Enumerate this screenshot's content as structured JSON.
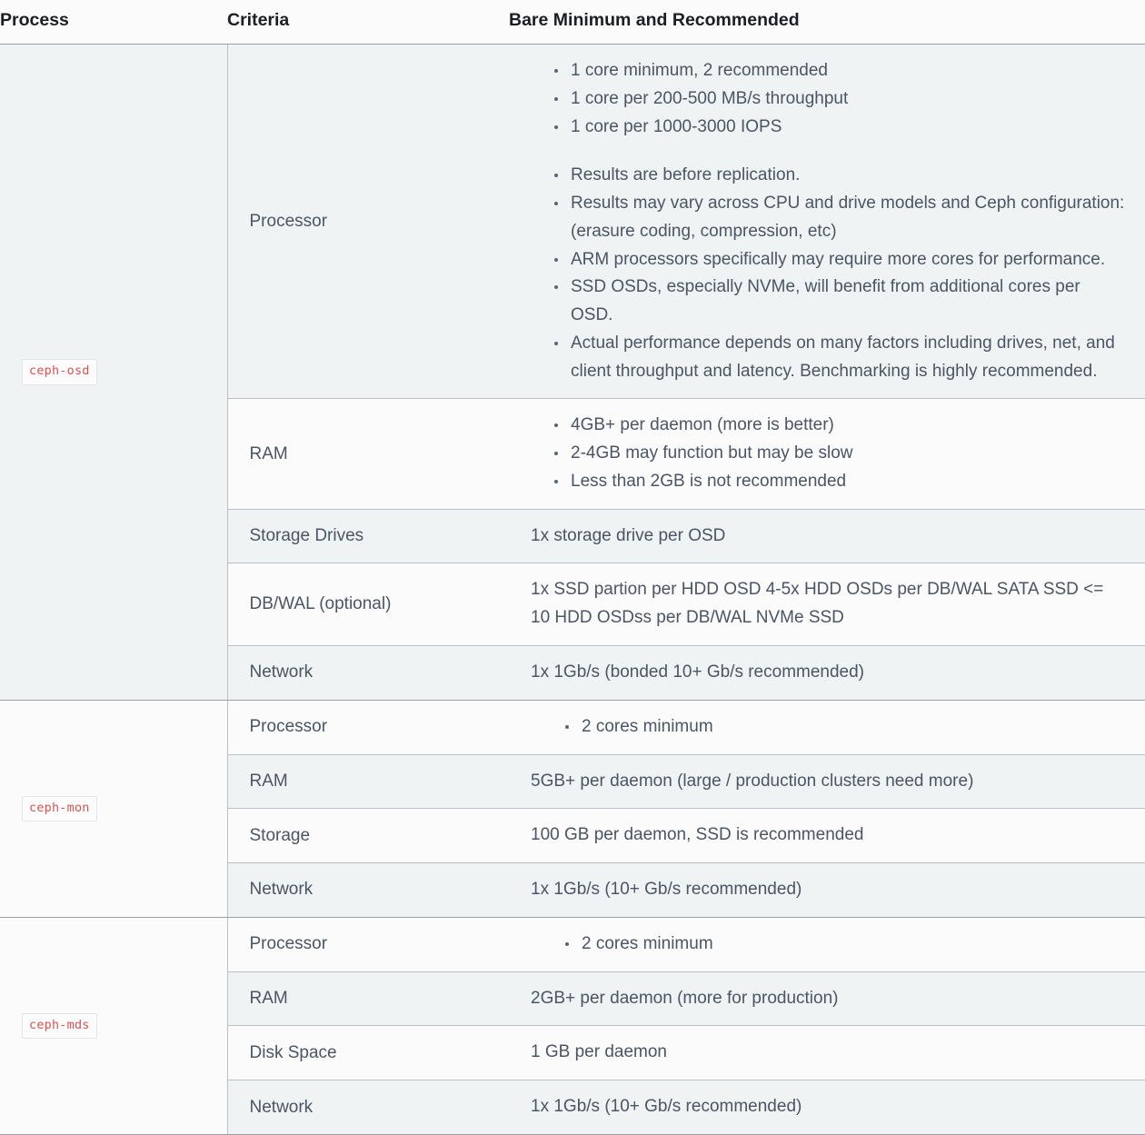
{
  "table": {
    "headers": {
      "process": "Process",
      "criteria": "Criteria",
      "spec": "Bare Minimum and Recommended"
    },
    "groups": [
      {
        "process": "ceph-osd",
        "rows": [
          {
            "criteria": "Processor",
            "list": [
              "1 core minimum, 2 recommended",
              "1 core per 200-500 MB/s throughput",
              "1 core per 1000-3000 IOPS",
              "Results are before replication.",
              "Results may vary across CPU and drive models and Ceph configuration: (erasure coding, compression, etc)",
              "ARM processors specifically may require more cores for performance.",
              "SSD OSDs, especially NVMe, will benefit from additional cores per OSD.",
              "Actual performance depends on many factors including drives, net, and client throughput and latency. Benchmarking is highly recommended."
            ],
            "gap_before_index": 3
          },
          {
            "criteria": "RAM",
            "list": [
              "4GB+ per daemon (more is better)",
              "2-4GB may function but may be slow",
              "Less than 2GB is not recommended"
            ]
          },
          {
            "criteria": "Storage Drives",
            "text": "1x storage drive per OSD"
          },
          {
            "criteria": "DB/WAL (optional)",
            "text": "1x SSD partion per HDD OSD 4-5x HDD OSDs per DB/WAL SATA SSD <= 10 HDD OSDss per DB/WAL NVMe SSD"
          },
          {
            "criteria": "Network",
            "text": "1x 1Gb/s (bonded 10+ Gb/s recommended)"
          }
        ]
      },
      {
        "process": "ceph-mon",
        "rows": [
          {
            "criteria": "Processor",
            "list": [
              "2 cores minimum"
            ],
            "indent_more": true
          },
          {
            "criteria": "RAM",
            "text": "5GB+ per daemon (large / production clusters need more)"
          },
          {
            "criteria": "Storage",
            "text": "100 GB per daemon, SSD is recommended"
          },
          {
            "criteria": "Network",
            "text": "1x 1Gb/s (10+ Gb/s recommended)"
          }
        ]
      },
      {
        "process": "ceph-mds",
        "rows": [
          {
            "criteria": "Processor",
            "list": [
              "2 cores minimum"
            ],
            "indent_more": true
          },
          {
            "criteria": "RAM",
            "text": "2GB+ per daemon (more for production)"
          },
          {
            "criteria": "Disk Space",
            "text": "1 GB per daemon"
          },
          {
            "criteria": "Network",
            "text": "1x 1Gb/s (10+ Gb/s recommended)"
          }
        ]
      }
    ]
  },
  "colors": {
    "row_shade": "#eff3f4",
    "row_plain": "#fbfbfc",
    "code_text": "#d9534f",
    "body_text": "#4b5563",
    "header_text": "#1b1f23",
    "border_strong": "#9aa0a6",
    "border_light": "#b9bfc4"
  }
}
